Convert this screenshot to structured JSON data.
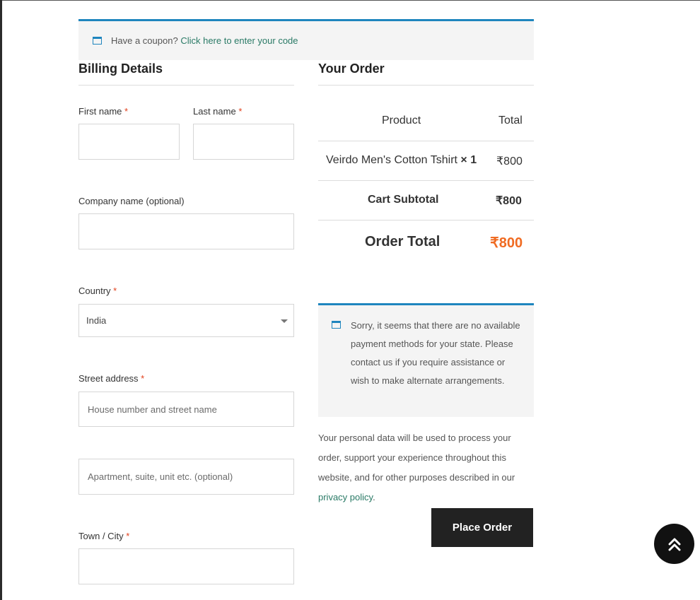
{
  "coupon": {
    "prompt": "Have a coupon?",
    "link": "Click here to enter your code"
  },
  "billing": {
    "title": "Billing Details",
    "required_marker": "*",
    "first_name_label": "First name",
    "last_name_label": "Last name",
    "company_label": "Company name (optional)",
    "country_label": "Country",
    "country_value": "India",
    "street_label": "Street address",
    "street_placeholder": "House number and street name",
    "apartment_placeholder": "Apartment, suite, unit etc. (optional)",
    "city_label": "Town / City"
  },
  "order": {
    "title": "Your Order",
    "col_product": "Product",
    "col_total": "Total",
    "item_name": "Veirdo Men's Cotton Tshirt",
    "item_qty": "× 1",
    "item_total": "₹800",
    "subtotal_label": "Cart Subtotal",
    "subtotal_value": "₹800",
    "order_total_label": "Order Total",
    "order_total_value": "₹800"
  },
  "payment_notice": "Sorry, it seems that there are no available payment methods for your state. Please contact us if you require assistance or wish to make alternate arrangements.",
  "privacy": {
    "text": "Your personal data will be used to process your order, support your experience throughout this website, and for other purposes described in our",
    "link": "privacy policy",
    "end": "."
  },
  "place_order_label": "Place Order",
  "colors": {
    "accent_blue": "#1e85be",
    "link_green": "#2a7a66",
    "price_orange": "#f06b22",
    "required_red": "#e2401c",
    "button_dark": "#222222"
  },
  "icons": {
    "notice": "info-window-icon",
    "scroll_top": "double-chevron-up-icon"
  }
}
